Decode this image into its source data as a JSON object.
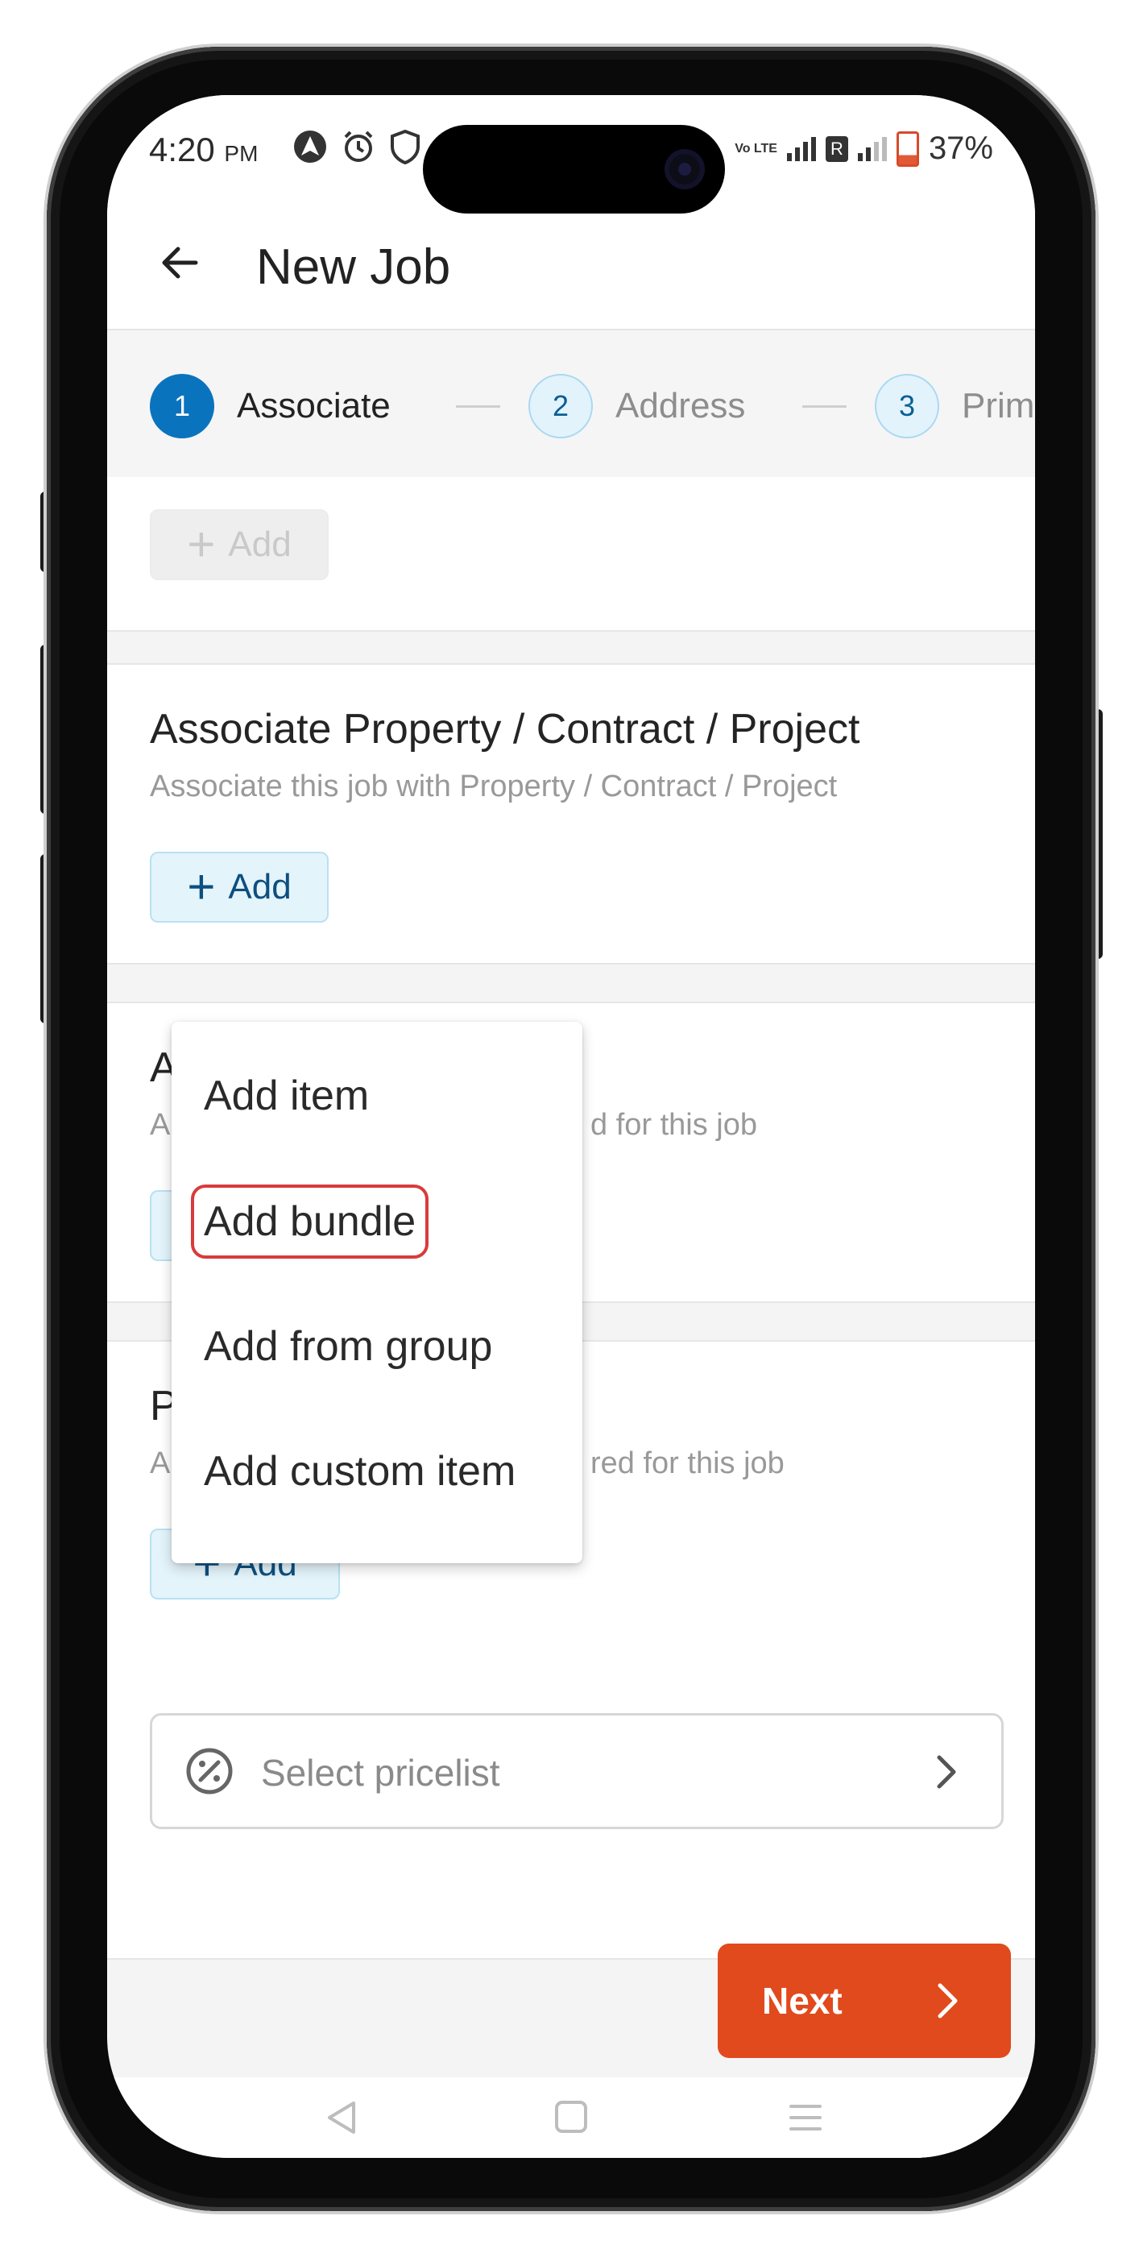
{
  "status_bar": {
    "time": "4:20",
    "ampm": "PM",
    "network_label": "Vo LTE",
    "sim_badge": "R",
    "battery": "37%"
  },
  "app_bar": {
    "back_icon": "arrow-left-icon",
    "title": "New Job"
  },
  "stepper": {
    "steps": [
      {
        "number": "1",
        "label": "Associate",
        "state": "active"
      },
      {
        "number": "2",
        "label": "Address",
        "state": "todo"
      },
      {
        "number": "3",
        "label": "Prim",
        "state": "todo"
      }
    ]
  },
  "sections": {
    "top_add": {
      "add_label": "Add",
      "disabled": true
    },
    "associate": {
      "title": "Associate Property / Contract / Project",
      "subtitle": "Associate this job with Property / Contract / Project",
      "add_label": "Add"
    },
    "items_partial": {
      "title_visible": "A",
      "subtitle_visible_left": "A",
      "subtitle_visible_right": "d for this job"
    },
    "parts_partial": {
      "title_visible": "P",
      "subtitle_visible_left": "A",
      "subtitle_visible_right": "red for this job",
      "add_label": "Add"
    }
  },
  "dropdown_menu": {
    "items": [
      "Add item",
      "Add bundle",
      "Add from group",
      "Add custom item"
    ],
    "highlighted": "Add bundle"
  },
  "pricelist": {
    "placeholder": "Select pricelist",
    "icon": "percent-badge-icon",
    "chevron": "chevron-right-icon"
  },
  "footer": {
    "next_label": "Next"
  },
  "colors": {
    "primary": "#0a73be",
    "accent_orange": "#e14a1c",
    "highlight_outline": "#d93b3b",
    "add_button_bg": "#e4f4fb"
  }
}
